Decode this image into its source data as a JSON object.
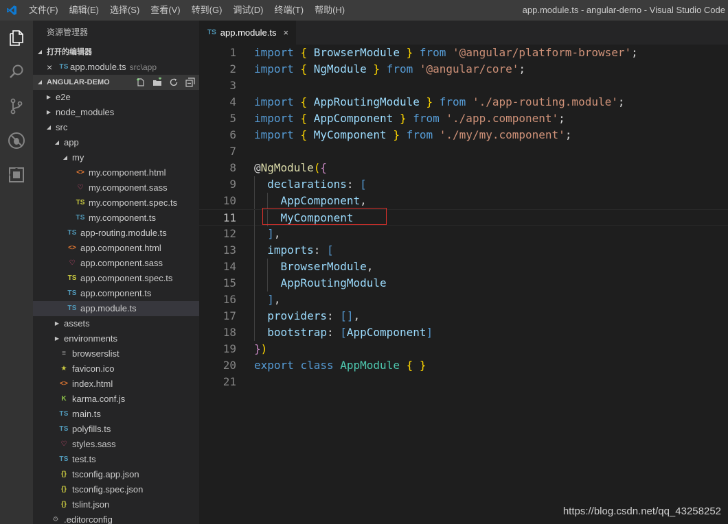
{
  "menubar": {
    "items": [
      "文件(F)",
      "编辑(E)",
      "选择(S)",
      "查看(V)",
      "转到(G)",
      "调试(D)",
      "终端(T)",
      "帮助(H)"
    ],
    "window_title": "app.module.ts - angular-demo - Visual Studio Code"
  },
  "activity_bar": {
    "icons": [
      "explorer-icon",
      "search-icon",
      "source-control-icon",
      "debug-icon",
      "extensions-icon"
    ]
  },
  "sidebar": {
    "title": "资源管理器",
    "open_editors": {
      "header": "打开的编辑器",
      "items": [
        {
          "close": "×",
          "icon": "TS",
          "label": "app.module.ts",
          "desc": "src\\app"
        }
      ]
    },
    "project": {
      "header": "ANGULAR-DEMO",
      "tree": [
        {
          "label": "e2e",
          "icon": "folder",
          "twisty": "closed",
          "depth": 0
        },
        {
          "label": "node_modules",
          "icon": "folder",
          "twisty": "closed",
          "depth": 0
        },
        {
          "label": "src",
          "icon": "folder",
          "twisty": "open",
          "depth": 0
        },
        {
          "label": "app",
          "icon": "folder",
          "twisty": "open",
          "depth": 1
        },
        {
          "label": "my",
          "icon": "folder",
          "twisty": "open",
          "depth": 2
        },
        {
          "label": "my.component.html",
          "icon": "html",
          "depth": 3
        },
        {
          "label": "my.component.sass",
          "icon": "sass",
          "depth": 3
        },
        {
          "label": "my.component.spec.ts",
          "icon": "tsspec",
          "depth": 3
        },
        {
          "label": "my.component.ts",
          "icon": "ts",
          "depth": 3
        },
        {
          "label": "app-routing.module.ts",
          "icon": "ts",
          "depth": 2
        },
        {
          "label": "app.component.html",
          "icon": "html",
          "depth": 2
        },
        {
          "label": "app.component.sass",
          "icon": "sass",
          "depth": 2
        },
        {
          "label": "app.component.spec.ts",
          "icon": "tsspec",
          "depth": 2
        },
        {
          "label": "app.component.ts",
          "icon": "ts",
          "depth": 2
        },
        {
          "label": "app.module.ts",
          "icon": "ts",
          "depth": 2,
          "selected": true
        },
        {
          "label": "assets",
          "icon": "folder",
          "twisty": "closed",
          "depth": 1
        },
        {
          "label": "environments",
          "icon": "folder",
          "twisty": "closed",
          "depth": 1
        },
        {
          "label": "browserslist",
          "icon": "list",
          "depth": 1
        },
        {
          "label": "favicon.ico",
          "icon": "star",
          "depth": 1
        },
        {
          "label": "index.html",
          "icon": "html",
          "depth": 1
        },
        {
          "label": "karma.conf.js",
          "icon": "karma",
          "depth": 1
        },
        {
          "label": "main.ts",
          "icon": "ts",
          "depth": 1
        },
        {
          "label": "polyfills.ts",
          "icon": "ts",
          "depth": 1
        },
        {
          "label": "styles.sass",
          "icon": "sass",
          "depth": 1
        },
        {
          "label": "test.ts",
          "icon": "ts",
          "depth": 1
        },
        {
          "label": "tsconfig.app.json",
          "icon": "json",
          "depth": 1
        },
        {
          "label": "tsconfig.spec.json",
          "icon": "json",
          "depth": 1
        },
        {
          "label": "tslint.json",
          "icon": "json",
          "depth": 1
        },
        {
          "label": ".editorconfig",
          "icon": "gear",
          "depth": 0
        }
      ]
    }
  },
  "editor": {
    "tab": {
      "icon": "TS",
      "label": "app.module.ts",
      "close": "×"
    },
    "highlighted_line": 11,
    "lines": [
      [
        [
          "k",
          "import"
        ],
        [
          "p",
          " "
        ],
        [
          "b",
          "{"
        ],
        [
          "p",
          " "
        ],
        [
          "i",
          "BrowserModule"
        ],
        [
          "p",
          " "
        ],
        [
          "b",
          "}"
        ],
        [
          "p",
          " "
        ],
        [
          "k",
          "from"
        ],
        [
          "p",
          " "
        ],
        [
          "s",
          "'@angular/platform-browser'"
        ],
        [
          "p",
          ";"
        ]
      ],
      [
        [
          "k",
          "import"
        ],
        [
          "p",
          " "
        ],
        [
          "b",
          "{"
        ],
        [
          "p",
          " "
        ],
        [
          "i",
          "NgModule"
        ],
        [
          "p",
          " "
        ],
        [
          "b",
          "}"
        ],
        [
          "p",
          " "
        ],
        [
          "k",
          "from"
        ],
        [
          "p",
          " "
        ],
        [
          "s",
          "'@angular/core'"
        ],
        [
          "p",
          ";"
        ]
      ],
      [],
      [
        [
          "k",
          "import"
        ],
        [
          "p",
          " "
        ],
        [
          "b",
          "{"
        ],
        [
          "p",
          " "
        ],
        [
          "i",
          "AppRoutingModule"
        ],
        [
          "p",
          " "
        ],
        [
          "b",
          "}"
        ],
        [
          "p",
          " "
        ],
        [
          "k",
          "from"
        ],
        [
          "p",
          " "
        ],
        [
          "s",
          "'./app-routing.module'"
        ],
        [
          "p",
          ";"
        ]
      ],
      [
        [
          "k",
          "import"
        ],
        [
          "p",
          " "
        ],
        [
          "b",
          "{"
        ],
        [
          "p",
          " "
        ],
        [
          "i",
          "AppComponent"
        ],
        [
          "p",
          " "
        ],
        [
          "b",
          "}"
        ],
        [
          "p",
          " "
        ],
        [
          "k",
          "from"
        ],
        [
          "p",
          " "
        ],
        [
          "s",
          "'./app.component'"
        ],
        [
          "p",
          ";"
        ]
      ],
      [
        [
          "k",
          "import"
        ],
        [
          "p",
          " "
        ],
        [
          "b",
          "{"
        ],
        [
          "p",
          " "
        ],
        [
          "i",
          "MyComponent"
        ],
        [
          "p",
          " "
        ],
        [
          "b",
          "}"
        ],
        [
          "p",
          " "
        ],
        [
          "k",
          "from"
        ],
        [
          "p",
          " "
        ],
        [
          "s",
          "'./my/my.component'"
        ],
        [
          "p",
          ";"
        ]
      ],
      [],
      [
        [
          "p",
          "@"
        ],
        [
          "d",
          "NgModule"
        ],
        [
          "b",
          "("
        ],
        [
          "c",
          "{"
        ]
      ],
      [
        [
          "p",
          "  "
        ],
        [
          "i",
          "declarations"
        ],
        [
          "p",
          ": "
        ],
        [
          "sq",
          "["
        ]
      ],
      [
        [
          "p",
          "    "
        ],
        [
          "i",
          "AppComponent"
        ],
        [
          "p",
          ","
        ]
      ],
      [
        [
          "p",
          "    "
        ],
        [
          "i",
          "MyComponent"
        ]
      ],
      [
        [
          "p",
          "  "
        ],
        [
          "sq",
          "]"
        ],
        [
          "p",
          ","
        ]
      ],
      [
        [
          "p",
          "  "
        ],
        [
          "i",
          "imports"
        ],
        [
          "p",
          ": "
        ],
        [
          "sq",
          "["
        ]
      ],
      [
        [
          "p",
          "    "
        ],
        [
          "i",
          "BrowserModule"
        ],
        [
          "p",
          ","
        ]
      ],
      [
        [
          "p",
          "    "
        ],
        [
          "i",
          "AppRoutingModule"
        ]
      ],
      [
        [
          "p",
          "  "
        ],
        [
          "sq",
          "]"
        ],
        [
          "p",
          ","
        ]
      ],
      [
        [
          "p",
          "  "
        ],
        [
          "i",
          "providers"
        ],
        [
          "p",
          ": "
        ],
        [
          "sq",
          "[]"
        ],
        [
          "p",
          ","
        ]
      ],
      [
        [
          "p",
          "  "
        ],
        [
          "i",
          "bootstrap"
        ],
        [
          "p",
          ": "
        ],
        [
          "sq",
          "["
        ],
        [
          "i",
          "AppComponent"
        ],
        [
          "sq",
          "]"
        ]
      ],
      [
        [
          "c",
          "}"
        ],
        [
          "b",
          ")"
        ]
      ],
      [
        [
          "k",
          "export"
        ],
        [
          "p",
          " "
        ],
        [
          "k",
          "class"
        ],
        [
          "p",
          " "
        ],
        [
          "t",
          "AppModule"
        ],
        [
          "p",
          " "
        ],
        [
          "b",
          "{"
        ],
        [
          "p",
          " "
        ],
        [
          "b",
          "}"
        ]
      ],
      []
    ]
  },
  "watermark": "https://blog.csdn.net/qq_43258252"
}
